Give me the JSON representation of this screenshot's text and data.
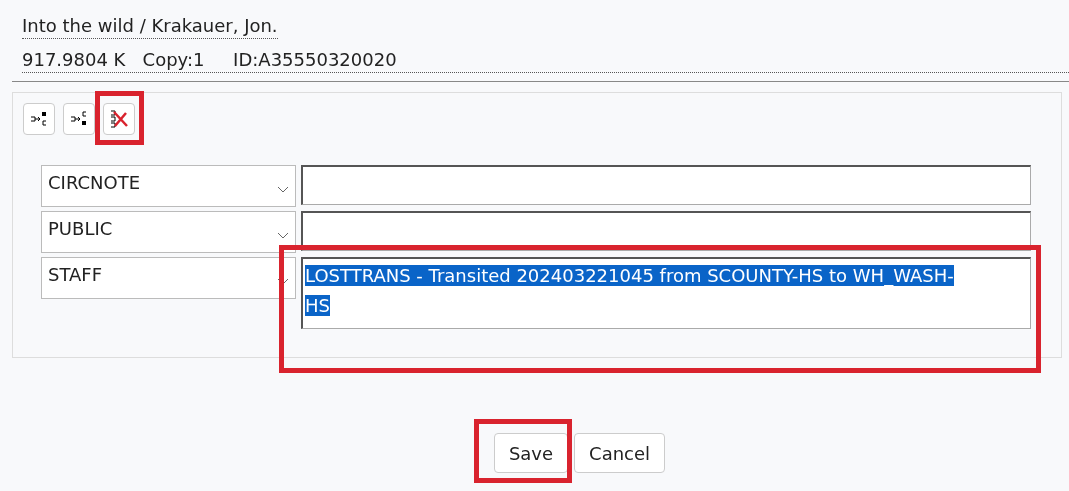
{
  "record": {
    "title": "Into the wild / Krakauer, Jon.",
    "call_number": "917.9804 K",
    "copy": "Copy:1",
    "item_id": "ID:A35550320020"
  },
  "toolbar": [
    {
      "kind": "add-before",
      "highlighted": false
    },
    {
      "kind": "add-after",
      "highlighted": false
    },
    {
      "kind": "delete",
      "highlighted": true
    }
  ],
  "notes": [
    {
      "type": "CIRCNOTE",
      "highlighted": false
    },
    {
      "type": "PUBLIC",
      "highlighted": false
    },
    {
      "type": "STAFF",
      "text": "LOSTTRANS - Transited 202403221045 from SCOUNTY-HS to WH_WASH-HS",
      "text_selected": true,
      "highlighted": true
    }
  ],
  "buttons": [
    {
      "label": "Save",
      "highlighted": true
    },
    {
      "label": "Cancel",
      "highlighted": false
    }
  ]
}
